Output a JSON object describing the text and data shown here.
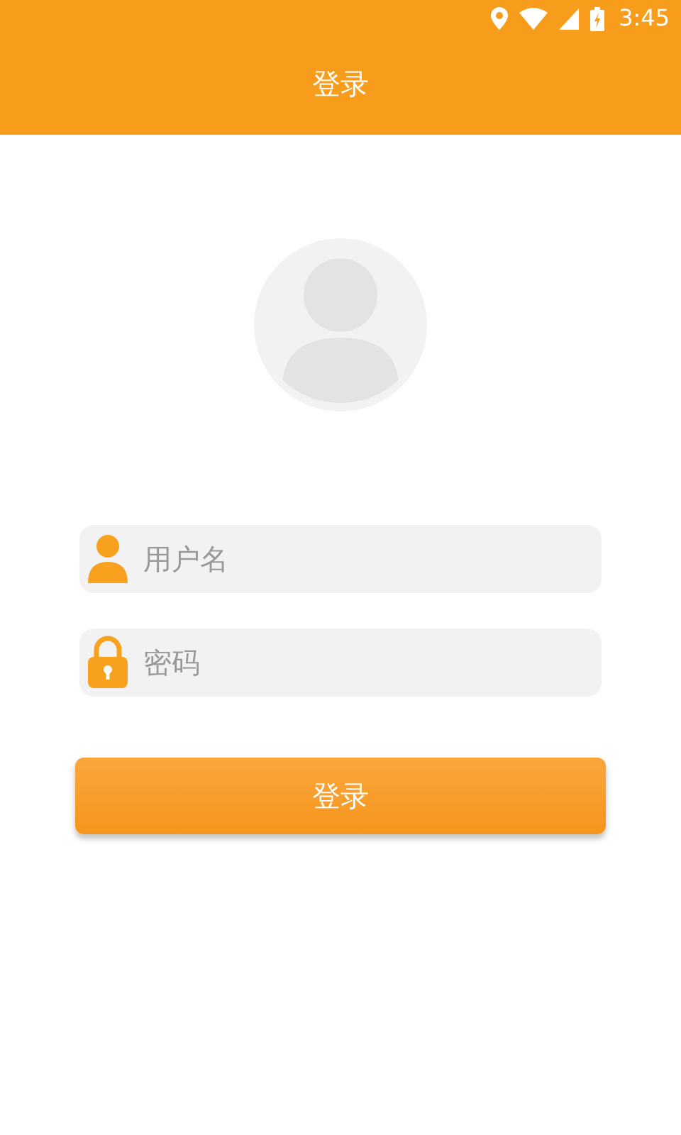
{
  "status_bar": {
    "time": "3:45"
  },
  "header": {
    "title": "登录"
  },
  "fields": [
    {
      "kind": "user",
      "placeholder": "用户名"
    },
    {
      "kind": "password",
      "placeholder": "密码"
    }
  ],
  "login_button": {
    "label": "登录"
  }
}
